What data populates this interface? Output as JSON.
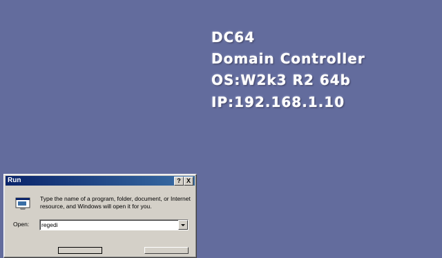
{
  "desktop": {
    "bginfo": {
      "hostname": "DC64",
      "role": "Domain Controller",
      "os": "OS:W2k3 R2 64b",
      "ip": "IP:192.168.1.10"
    }
  },
  "run_dialog": {
    "title": "Run",
    "help_button": "?",
    "close_button": "X",
    "prompt": "Type the name of a program, folder, document, or Internet resource, and Windows will open it for you.",
    "open_label": "Open:",
    "open_value": "regedi",
    "icon": "run-icon"
  },
  "colors": {
    "desktop_background": "#636c9d",
    "titlebar_start": "#0a246a",
    "titlebar_end": "#3a6ea5",
    "dialog_face": "#d4d0c8"
  }
}
